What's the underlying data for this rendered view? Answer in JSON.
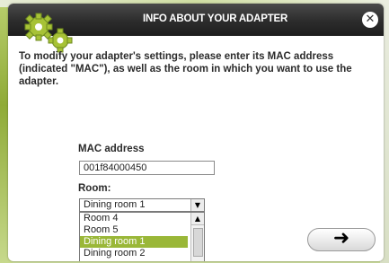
{
  "dialog": {
    "title": "INFO ABOUT YOUR ADAPTER",
    "close_symbol": "✕",
    "intro_text": "To modify your adapter's settings, please enter its MAC address (indicated \"MAC\"), as well as the room in which you want to use the adapter."
  },
  "form": {
    "mac_label": "MAC address",
    "mac_value": "001f84000450",
    "room_label": "Room:",
    "room_selected": "Dining room 1",
    "room_options": [
      "Room 4",
      "Room 5",
      "Dining room 1",
      "Dining room 2"
    ]
  },
  "next_button": {
    "symbol": "➜"
  },
  "colors": {
    "accent": "#9ab738",
    "header": "#2c2c2c"
  },
  "icons": {
    "logo": "gears-icon",
    "close": "close-icon",
    "next": "arrow-right-icon"
  }
}
